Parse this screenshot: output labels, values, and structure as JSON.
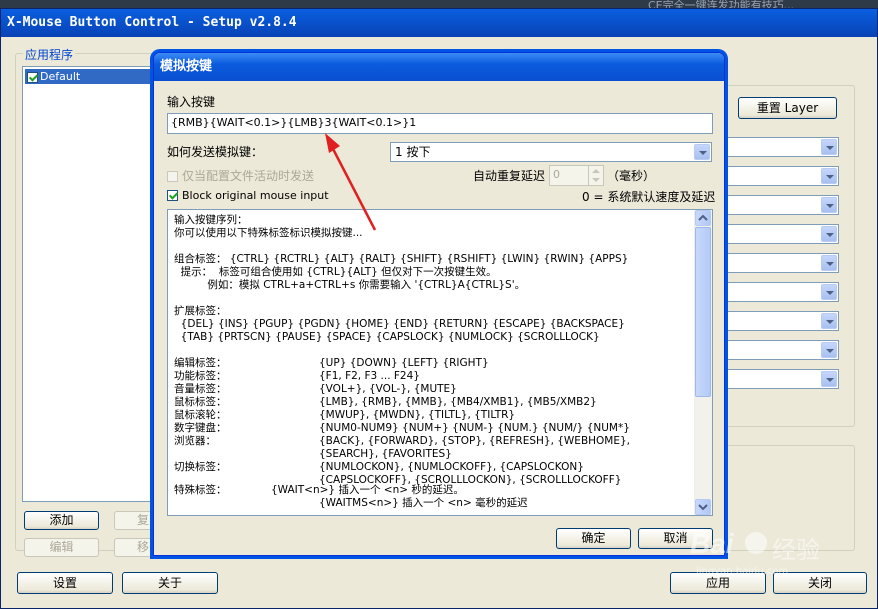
{
  "window": {
    "title": "X-Mouse Button Control - Setup v2.8.4",
    "behind_text": "CE完全一键连发功能有技巧..."
  },
  "main": {
    "apps_group_label": "应用程序",
    "apps_list": [
      {
        "label": "Default",
        "checked": true,
        "selected": true
      }
    ],
    "buttons": {
      "add": "添加",
      "copy": "复制",
      "edit": "编辑",
      "remove": "移除",
      "reset_layer": "重置 Layer",
      "settings": "设置",
      "about": "关于",
      "apply": "应用",
      "close": "关闭"
    }
  },
  "dialog": {
    "title": "模拟按键",
    "input_label": "输入按键",
    "input_value": "{RMB}{WAIT<0.1>}{LMB}3{WAIT<0.1>}1",
    "send_mode_label": "如何发送模拟键：",
    "send_mode_value": "1 按下",
    "only_when_profile_active": "仅当配置文件活动时发送",
    "block_original": "Block original mouse input",
    "block_original_checked": true,
    "auto_repeat_label": "自动重复延迟",
    "auto_repeat_value": "0",
    "ms_unit": "（毫秒）",
    "repeat_note": "0 = 系统默认速度及延迟",
    "ok": "确定",
    "cancel": "取消",
    "help_lines": [
      "输入按键序列：",
      "你可以使用以下特殊标签标识模拟按键...",
      "",
      "组合标签： {CTRL} {RCTRL} {ALT} {RALT} {SHIFT} {RSHIFT} {LWIN} {RWIN} {APPS}",
      "  提示：  标签可组合使用如 {CTRL}{ALT} 但仅对下一次按键生效。",
      "          例如：模拟 CTRL+a+CTRL+s 你需要输入 '{CTRL}A{CTRL}S'。",
      "",
      "扩展标签：",
      "  {DEL} {INS} {PGUP} {PGDN} {HOME} {END} {RETURN} {ESCAPE} {BACKSPACE}",
      "  {TAB} {PRTSCN} {PAUSE} {SPACE} {CAPSLOCK} {NUMLOCK} {SCROLLLOCK}",
      ""
    ],
    "help_table": [
      {
        "label": "编辑标签：",
        "value": "{UP} {DOWN} {LEFT} {RIGHT}"
      },
      {
        "label": "功能标签：",
        "value": "{F1, F2, F3 ... F24}"
      },
      {
        "label": "音量标签：",
        "value": "{VOL+}, {VOL-}, {MUTE}"
      },
      {
        "label": "鼠标标签：",
        "value": "{LMB}, {RMB}, {MMB}, {MB4/XMB1}, {MB5/XMB2}"
      },
      {
        "label": "鼠标滚轮：",
        "value": "{MWUP}, {MWDN}, {TILTL}, {TILTR}"
      },
      {
        "label": "数字键盘：",
        "value": "{NUM0-NUM9} {NUM+} {NUM-} {NUM.} {NUM/} {NUM*}"
      },
      {
        "label": "浏览器：",
        "value": "{BACK}, {FORWARD}, {STOP}, {REFRESH}, {WEBHOME},"
      },
      {
        "label": "",
        "value": "{SEARCH}, {FAVORITES}"
      },
      {
        "label": "切换标签：",
        "value": "{NUMLOCKON}, {NUMLOCKOFF}, {CAPSLOCKON}"
      },
      {
        "label": "",
        "value": "{CAPSLOCKOFF}, {SCROLLLOCKON}, {SCROLLLOCKOFF}"
      }
    ],
    "special_label": "特殊标签：",
    "special_lines": [
      "{WAIT<n>} 插入一个 <n> 秒的延迟。",
      "{WAITMS<n>} 插入一个 <n> 毫秒的延迟"
    ]
  },
  "watermark": {
    "brand": "Bai",
    "brand_suffix": "经验",
    "url": "jingyan.baidu.com"
  },
  "colors": {
    "title_bar": "#0a4fd1",
    "arrow": "#e02020",
    "selection": "#316ac5"
  },
  "icons": [
    "checkbox-checked-icon",
    "dropdown-arrow-icon",
    "spin-up-icon",
    "spin-down-icon",
    "scroll-up-icon",
    "scroll-down-icon",
    "red-arrow-annotation"
  ]
}
